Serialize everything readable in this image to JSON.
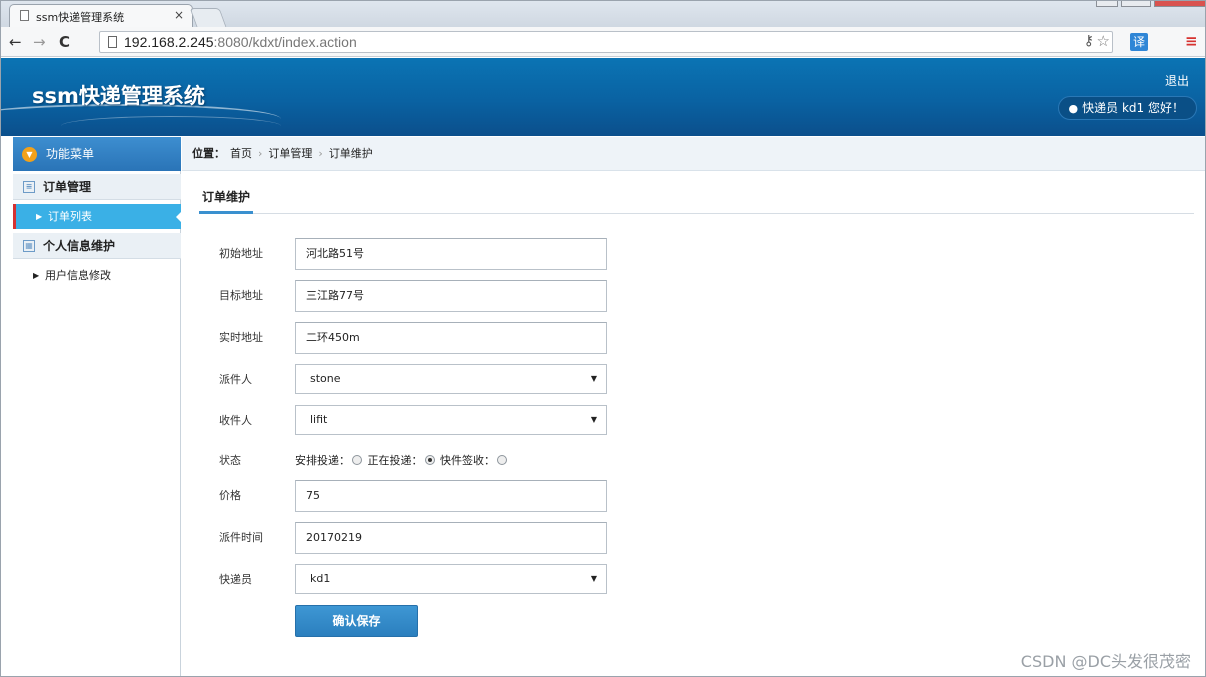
{
  "browser": {
    "tab_title": "ssm快递管理系统",
    "tab_close": "×",
    "back_icon": "←",
    "forward_icon": "→",
    "reload_icon": "C",
    "url_host": "192.168.2.245",
    "url_rest": ":8080/kdxt/index.action",
    "translate_label": "译"
  },
  "header": {
    "app_title": "ssm快递管理系统",
    "logout_label": "退出",
    "user_greeting": "快递员 kd1 您好！"
  },
  "sidebar": {
    "menu_title": "功能菜单",
    "groups": [
      {
        "label": "订单管理",
        "items": [
          {
            "label": "订单列表"
          }
        ]
      },
      {
        "label": "个人信息维护",
        "items": [
          {
            "label": "用户信息修改"
          }
        ]
      }
    ]
  },
  "breadcrumb": {
    "label": "位置：",
    "items": [
      "首页",
      "订单管理",
      "订单维护"
    ]
  },
  "form": {
    "tab_title": "订单维护",
    "fields": {
      "start_address": {
        "label": "初始地址",
        "value": "河北路51号"
      },
      "target_address": {
        "label": "目标地址",
        "value": "三江路77号"
      },
      "current_address": {
        "label": "实时地址",
        "value": "二环450m"
      },
      "sender": {
        "label": "派件人",
        "value": "stone"
      },
      "receiver": {
        "label": "收件人",
        "value": "lifit"
      },
      "status": {
        "label": "状态",
        "options": [
          "安排投递：",
          "正在投递：",
          "快件签收："
        ],
        "selected_index": 1
      },
      "price": {
        "label": "价格",
        "value": "75"
      },
      "dispatch_time": {
        "label": "派件时间",
        "value": "20170219"
      },
      "courier": {
        "label": "快递员",
        "value": "kd1"
      }
    },
    "save_label": "确认保存"
  },
  "watermark": "CSDN @DC头发很茂密",
  "colors": {
    "header_bg": "#0a62a2",
    "menu_title_bg": "#2a74b7",
    "active_item_bg": "#3ab0e6",
    "active_item_marker": "#d53232",
    "save_button_bg": "#2b7fbe"
  }
}
